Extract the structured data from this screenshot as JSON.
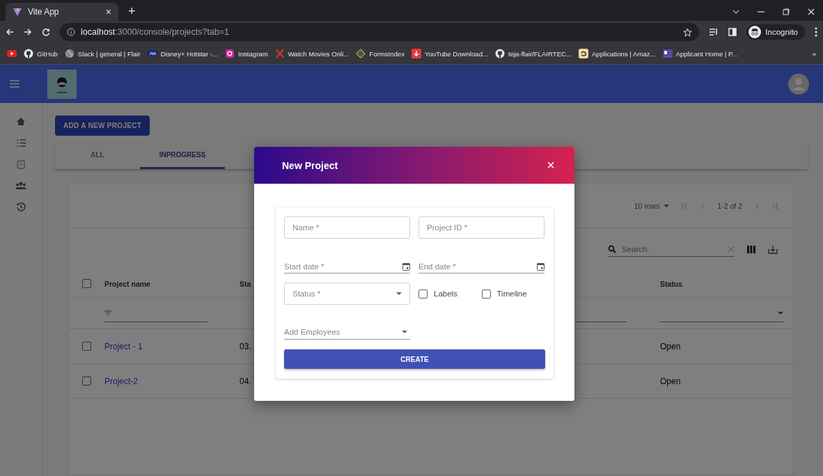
{
  "browser": {
    "tab": {
      "title": "Vite App",
      "close": "×",
      "new_tab": "+"
    },
    "url": {
      "host": "localhost",
      "path": ":3000/console/projects?tab=1"
    },
    "profile": "Incognito",
    "bookmarks": [
      {
        "kind": "youtube"
      },
      {
        "kind": "github",
        "label": "GitHub"
      },
      {
        "kind": "globe",
        "label": "Slack | general | Flair"
      },
      {
        "kind": "hotstar",
        "label": "Disney+ Hotstar -..."
      },
      {
        "kind": "instagram",
        "label": "Instagram"
      },
      {
        "kind": "cross",
        "label": "Watch Movies Onli..."
      },
      {
        "kind": "forms",
        "label": "FormsIndex"
      },
      {
        "kind": "download",
        "label": "YouTube Download..."
      },
      {
        "kind": "github",
        "label": "teja-flair/FLAIRTEC..."
      },
      {
        "kind": "amazon",
        "label": "Applications | Amaz..."
      },
      {
        "kind": "applicant",
        "label": "Applicant Home | P..."
      }
    ],
    "overflow": "»"
  },
  "app": {
    "add_button": "ADD A NEW PROJECT",
    "tabs": [
      {
        "label": "ALL",
        "selected": false
      },
      {
        "label": "INPROGRESS",
        "selected": true
      }
    ],
    "table": {
      "rows_per_page": "10 rows",
      "range": "1-2 of 2",
      "search": {
        "placeholder": "Search"
      },
      "all_checked": false,
      "columns": [
        "Project name",
        "Sta",
        "Status"
      ],
      "rows": [
        {
          "checked": false,
          "cells": [
            "Project - 1",
            "03.",
            "Open"
          ]
        },
        {
          "checked": false,
          "cells": [
            "Project-2",
            "04.",
            "Open"
          ]
        }
      ]
    }
  },
  "dialog": {
    "title": "New Project",
    "close": "×",
    "fields": [
      {
        "kind": "text",
        "placeholder": "Name *"
      },
      {
        "kind": "text",
        "placeholder": "Project ID *"
      },
      {
        "kind": "date",
        "placeholder": "Start date *"
      },
      {
        "kind": "date",
        "placeholder": "End date *"
      },
      {
        "kind": "select",
        "placeholder": "Status *"
      },
      {
        "kind": "checkbox",
        "label": "Labels",
        "checked": false
      },
      {
        "kind": "checkbox",
        "label": "Timeline",
        "checked": false
      },
      {
        "kind": "autocomplete",
        "placeholder": "Add Employees"
      }
    ],
    "submit": "CREATE"
  }
}
